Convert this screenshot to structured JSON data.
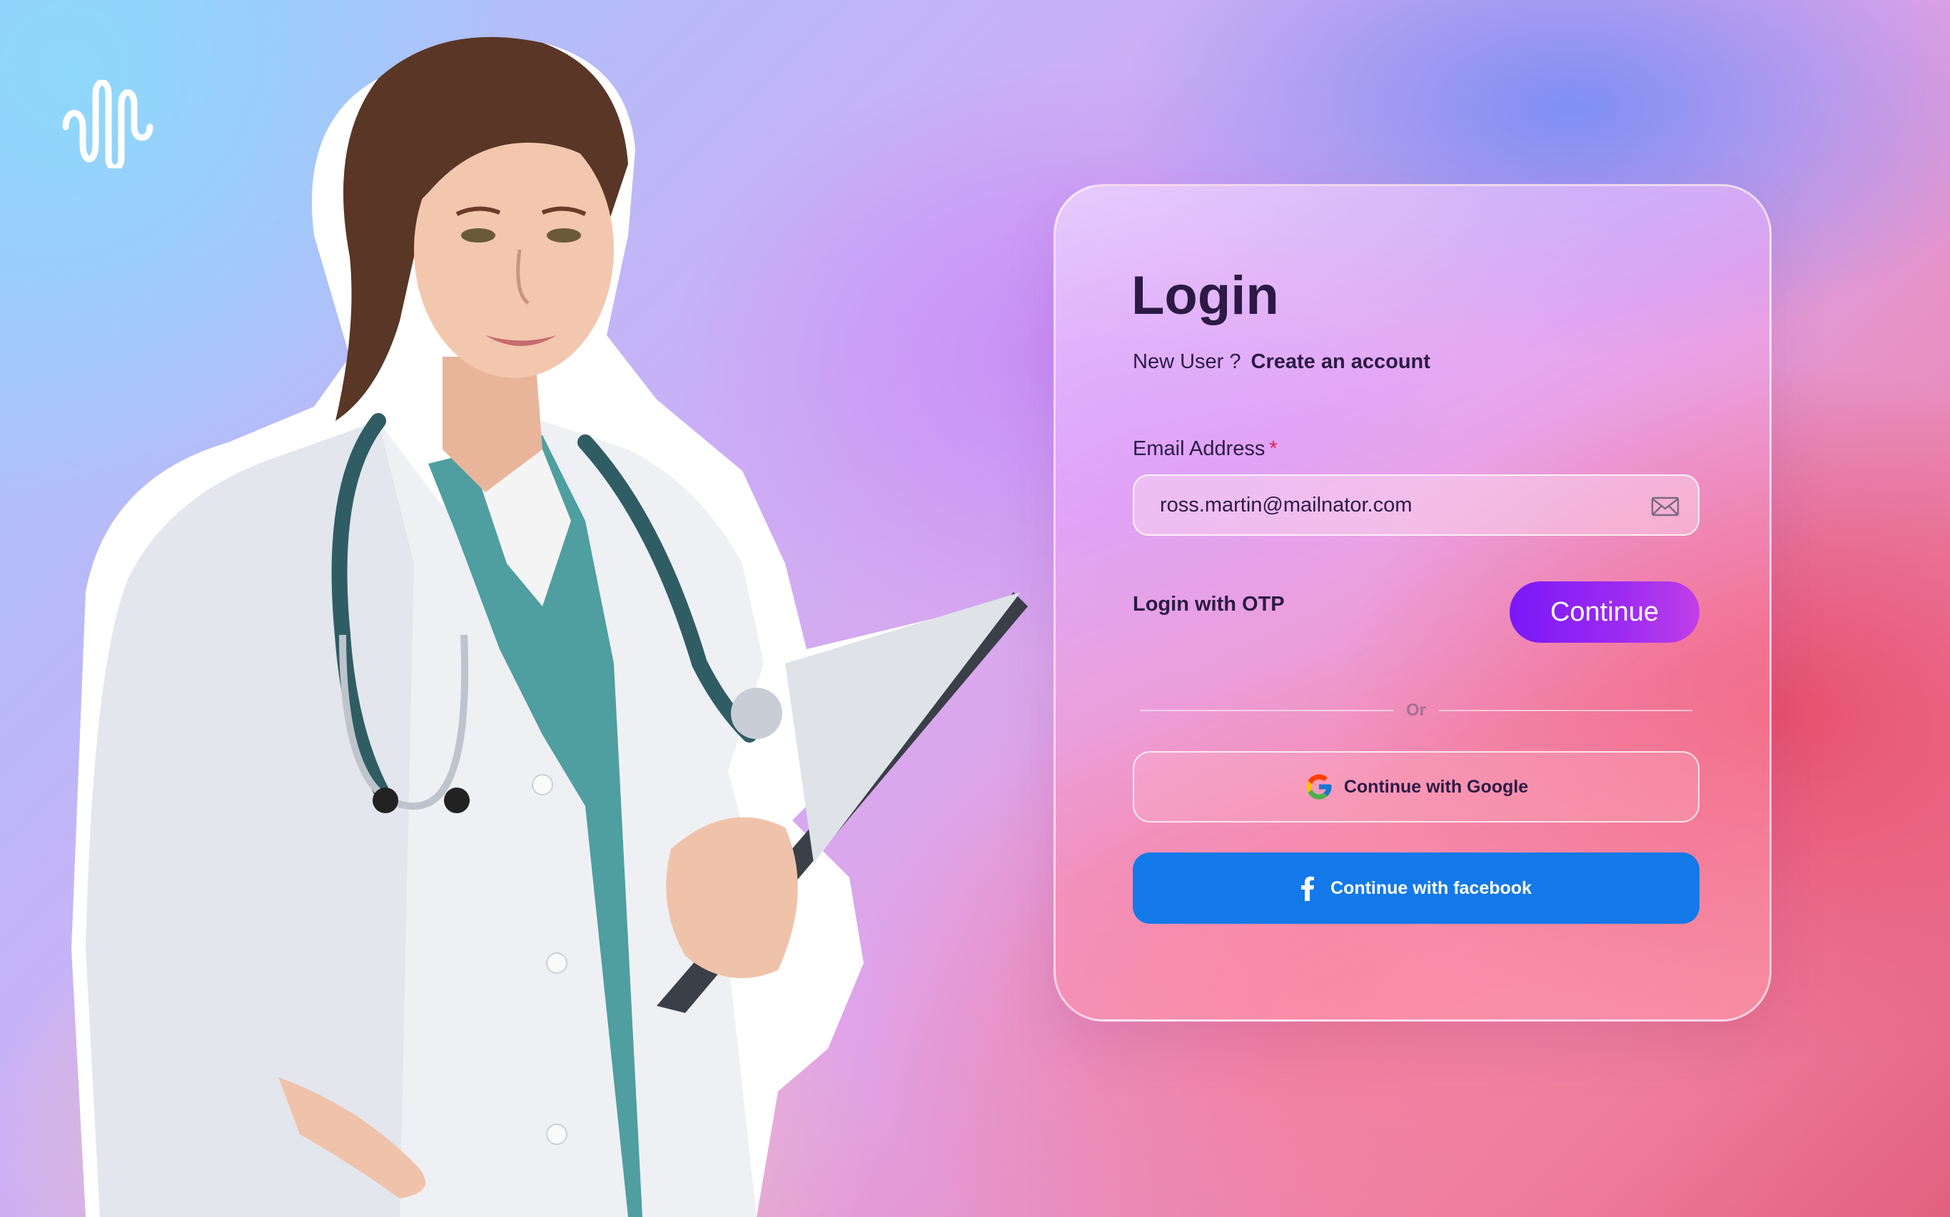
{
  "brand": {
    "logo_icon": "waveform-logo-icon"
  },
  "login": {
    "title": "Login",
    "new_user_text": "New User ?",
    "create_account_link": "Create an account",
    "email_label": "Email Address",
    "email_required_mark": "*",
    "email_value": "ross.martin@mailnator.com",
    "email_icon": "mail-icon",
    "login_with_otp": "Login with OTP",
    "continue_button": "Continue",
    "divider_text": "Or",
    "google_button": "Continue with Google",
    "google_icon": "google-icon",
    "facebook_button": "Continue with facebook",
    "facebook_icon": "facebook-icon"
  },
  "colors": {
    "primary_gradient_start": "#7a18f6",
    "primary_gradient_end": "#c03fe8",
    "facebook_blue": "#1479e8",
    "required_red": "#e0214f",
    "text_dark": "#2c1a45"
  },
  "illustration": "doctor-with-clipboard-and-stethoscope"
}
